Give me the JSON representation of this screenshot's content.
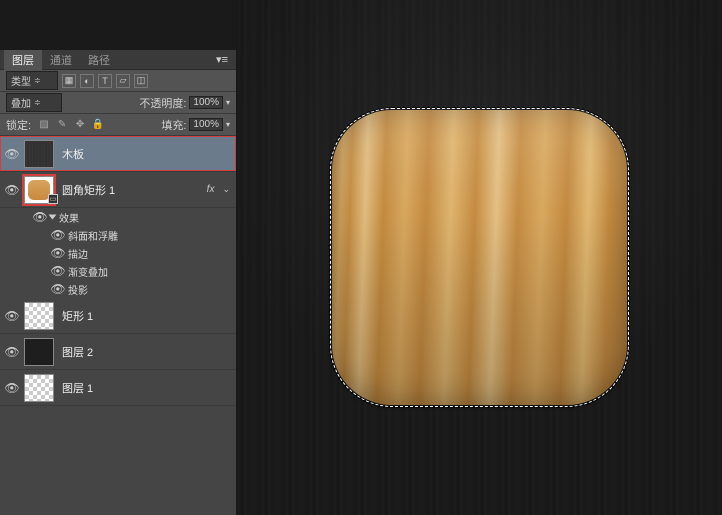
{
  "tabs": {
    "layers": "图层",
    "channels": "通道",
    "paths": "路径"
  },
  "toolbar": {
    "type_label": "类型",
    "blend_mode": "叠加",
    "opacity_label": "不透明度:",
    "opacity_value": "100%",
    "lock_label": "锁定:",
    "fill_label": "填充:",
    "fill_value": "100%"
  },
  "layers": [
    {
      "name": "木板"
    },
    {
      "name": "圆角矩形 1",
      "fx": "fx"
    },
    {
      "name": "矩形 1"
    },
    {
      "name": "图层 2"
    },
    {
      "name": "图层 1"
    }
  ],
  "effects": {
    "title": "效果",
    "items": [
      "斜面和浮雕",
      "描边",
      "渐变叠加",
      "投影"
    ]
  }
}
